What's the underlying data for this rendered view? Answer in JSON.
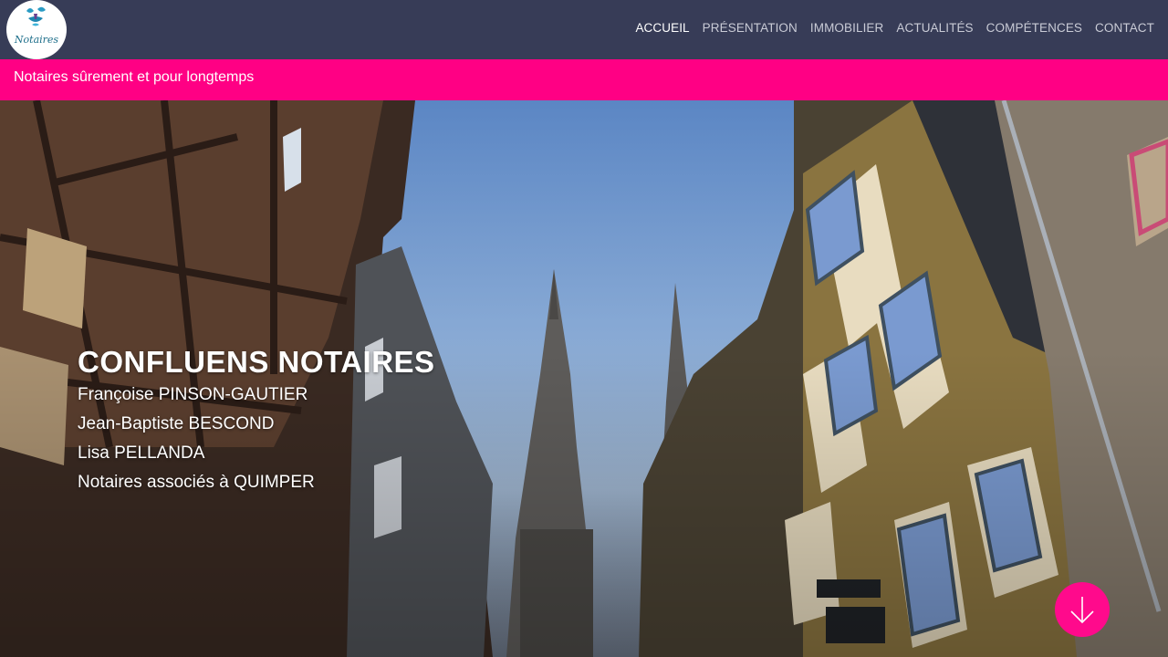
{
  "header": {
    "logo_text": "Notaires",
    "nav": [
      {
        "label": "ACCUEIL",
        "active": true
      },
      {
        "label": "PRÉSENTATION",
        "active": false
      },
      {
        "label": "IMMOBILIER",
        "active": false
      },
      {
        "label": "ACTUALITÉS",
        "active": false
      },
      {
        "label": "COMPÉTENCES",
        "active": false
      },
      {
        "label": "CONTACT",
        "active": false
      }
    ]
  },
  "tagline": "Notaires sûrement et pour longtemps",
  "hero": {
    "title": "CONFLUENS NOTAIRES",
    "lines": [
      "Françoise PINSON-GAUTIER",
      "Jean-Baptiste BESCOND",
      "Lisa PELLANDA",
      "Notaires associés à QUIMPER"
    ]
  },
  "colors": {
    "header_bg": "#373c57",
    "accent": "#ff0084",
    "text_light": "#ffffff"
  },
  "icons": {
    "scroll": "arrow-down-icon"
  }
}
